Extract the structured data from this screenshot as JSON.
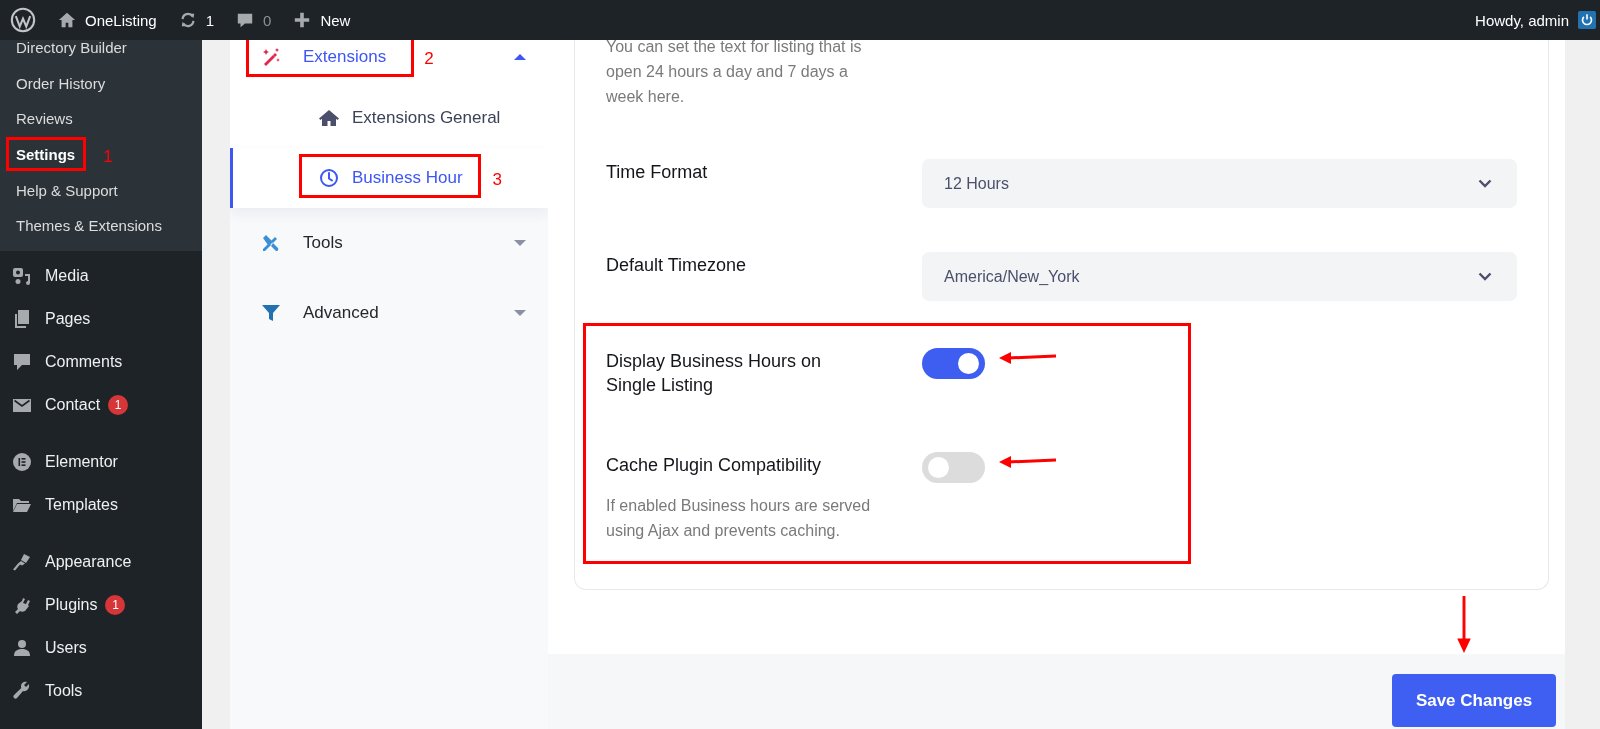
{
  "topbar": {
    "site_name": "OneListing",
    "updates": "1",
    "comments": "0",
    "new_label": "New",
    "greeting": "Howdy, admin"
  },
  "admin_menu": {
    "submenu": [
      {
        "label": "Directory Builder",
        "selected": false
      },
      {
        "label": "Order History",
        "selected": false
      },
      {
        "label": "Reviews",
        "selected": false
      },
      {
        "label": "Settings",
        "selected": true,
        "annotation": "1"
      },
      {
        "label": "Help & Support",
        "selected": false
      },
      {
        "label": "Themes & Extensions",
        "selected": false
      }
    ],
    "groups": [
      [
        {
          "label": "Media"
        },
        {
          "label": "Pages"
        },
        {
          "label": "Comments"
        },
        {
          "label": "Contact",
          "badge": "1"
        }
      ],
      [
        {
          "label": "Elementor"
        },
        {
          "label": "Templates"
        }
      ],
      [
        {
          "label": "Appearance"
        },
        {
          "label": "Plugins",
          "badge": "1"
        },
        {
          "label": "Users"
        },
        {
          "label": "Tools"
        }
      ]
    ]
  },
  "settings_nav": [
    {
      "label": "Extensions",
      "expanded": true,
      "selected": true,
      "annotation": "2",
      "children": [
        {
          "label": "Extensions General",
          "selected": false
        },
        {
          "label": "Business Hour",
          "selected": true,
          "annotation": "3"
        }
      ]
    },
    {
      "label": "Tools",
      "expanded": false,
      "selected": false
    },
    {
      "label": "Advanced",
      "expanded": false,
      "selected": false
    }
  ],
  "settings": [
    {
      "kind": "text",
      "description": "You can set the text for listing that is open 24 hours a day and 7 days a week here."
    },
    {
      "kind": "select",
      "label": "Time Format",
      "value": "12 Hours"
    },
    {
      "kind": "select",
      "label": "Default Timezone",
      "value": "America/New_York"
    }
  ],
  "highlighted_settings": [
    {
      "kind": "toggle",
      "label": "Display Business Hours on Single Listing",
      "on": true
    },
    {
      "kind": "toggle",
      "label": "Cache Plugin Compatibility",
      "on": false,
      "description": "If enabled Business hours are served using Ajax and prevents caching."
    }
  ],
  "save_button": "Save Changes"
}
